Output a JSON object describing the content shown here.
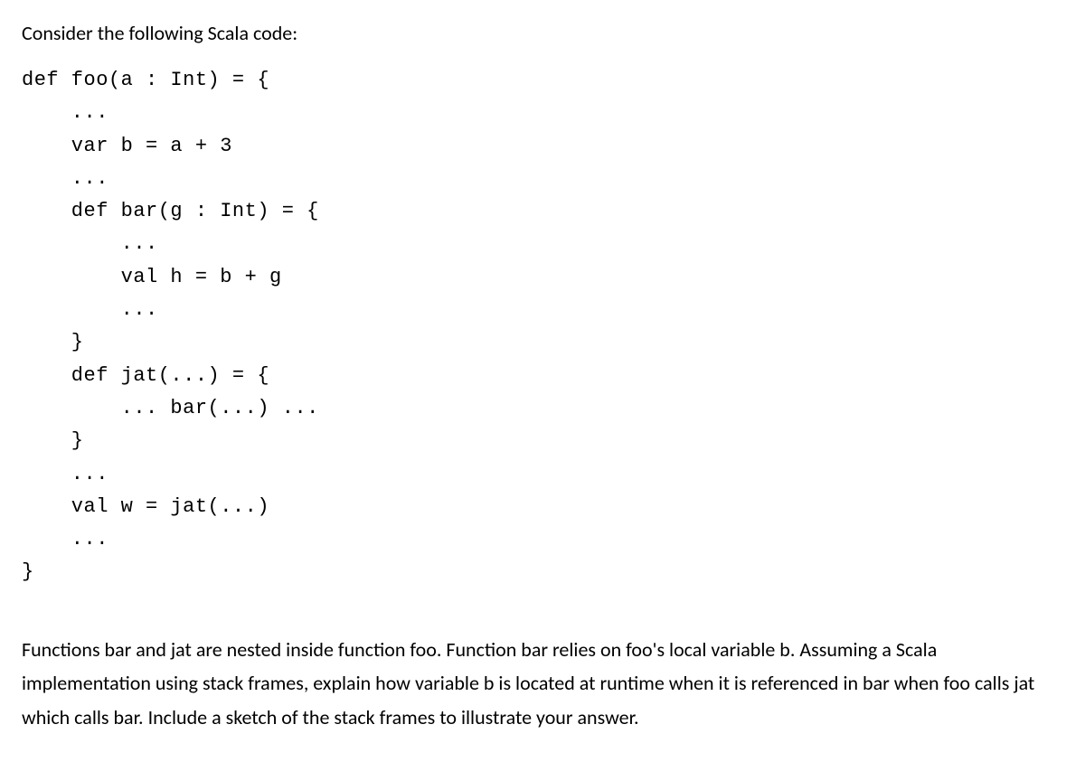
{
  "intro": "Consider the following Scala code:",
  "code": "def foo(a : Int) = {\n    ...\n    var b = a + 3\n    ...\n    def bar(g : Int) = {\n        ...\n        val h = b + g\n        ...\n    }\n    def jat(...) = {\n        ... bar(...) ...\n    }\n    ...\n    val w = jat(...)\n    ...\n}",
  "question": "Functions bar and jat are nested inside function foo. Function bar relies on foo's local variable b. Assuming a Scala implementation using stack frames, explain how variable b is located at runtime when it is referenced in bar when foo calls jat which calls bar. Include a sketch of the stack frames to illustrate your answer."
}
